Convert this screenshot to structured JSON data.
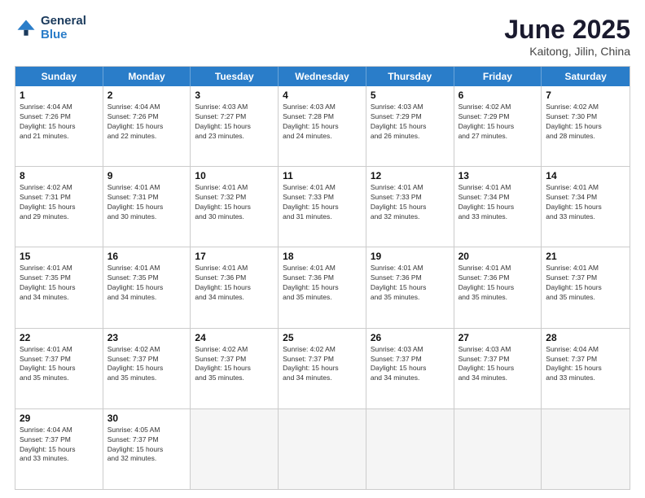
{
  "header": {
    "logo_line1": "General",
    "logo_line2": "Blue",
    "month": "June 2025",
    "location": "Kaitong, Jilin, China"
  },
  "weekdays": [
    "Sunday",
    "Monday",
    "Tuesday",
    "Wednesday",
    "Thursday",
    "Friday",
    "Saturday"
  ],
  "rows": [
    [
      {
        "day": "",
        "empty": true,
        "lines": []
      },
      {
        "day": "2",
        "empty": false,
        "lines": [
          "Sunrise: 4:04 AM",
          "Sunset: 7:26 PM",
          "Daylight: 15 hours",
          "and 22 minutes."
        ]
      },
      {
        "day": "3",
        "empty": false,
        "lines": [
          "Sunrise: 4:03 AM",
          "Sunset: 7:27 PM",
          "Daylight: 15 hours",
          "and 23 minutes."
        ]
      },
      {
        "day": "4",
        "empty": false,
        "lines": [
          "Sunrise: 4:03 AM",
          "Sunset: 7:28 PM",
          "Daylight: 15 hours",
          "and 24 minutes."
        ]
      },
      {
        "day": "5",
        "empty": false,
        "lines": [
          "Sunrise: 4:03 AM",
          "Sunset: 7:29 PM",
          "Daylight: 15 hours",
          "and 26 minutes."
        ]
      },
      {
        "day": "6",
        "empty": false,
        "lines": [
          "Sunrise: 4:02 AM",
          "Sunset: 7:29 PM",
          "Daylight: 15 hours",
          "and 27 minutes."
        ]
      },
      {
        "day": "7",
        "empty": false,
        "lines": [
          "Sunrise: 4:02 AM",
          "Sunset: 7:30 PM",
          "Daylight: 15 hours",
          "and 28 minutes."
        ]
      }
    ],
    [
      {
        "day": "8",
        "empty": false,
        "lines": [
          "Sunrise: 4:02 AM",
          "Sunset: 7:31 PM",
          "Daylight: 15 hours",
          "and 29 minutes."
        ]
      },
      {
        "day": "9",
        "empty": false,
        "lines": [
          "Sunrise: 4:01 AM",
          "Sunset: 7:31 PM",
          "Daylight: 15 hours",
          "and 30 minutes."
        ]
      },
      {
        "day": "10",
        "empty": false,
        "lines": [
          "Sunrise: 4:01 AM",
          "Sunset: 7:32 PM",
          "Daylight: 15 hours",
          "and 30 minutes."
        ]
      },
      {
        "day": "11",
        "empty": false,
        "lines": [
          "Sunrise: 4:01 AM",
          "Sunset: 7:33 PM",
          "Daylight: 15 hours",
          "and 31 minutes."
        ]
      },
      {
        "day": "12",
        "empty": false,
        "lines": [
          "Sunrise: 4:01 AM",
          "Sunset: 7:33 PM",
          "Daylight: 15 hours",
          "and 32 minutes."
        ]
      },
      {
        "day": "13",
        "empty": false,
        "lines": [
          "Sunrise: 4:01 AM",
          "Sunset: 7:34 PM",
          "Daylight: 15 hours",
          "and 33 minutes."
        ]
      },
      {
        "day": "14",
        "empty": false,
        "lines": [
          "Sunrise: 4:01 AM",
          "Sunset: 7:34 PM",
          "Daylight: 15 hours",
          "and 33 minutes."
        ]
      }
    ],
    [
      {
        "day": "15",
        "empty": false,
        "lines": [
          "Sunrise: 4:01 AM",
          "Sunset: 7:35 PM",
          "Daylight: 15 hours",
          "and 34 minutes."
        ]
      },
      {
        "day": "16",
        "empty": false,
        "lines": [
          "Sunrise: 4:01 AM",
          "Sunset: 7:35 PM",
          "Daylight: 15 hours",
          "and 34 minutes."
        ]
      },
      {
        "day": "17",
        "empty": false,
        "lines": [
          "Sunrise: 4:01 AM",
          "Sunset: 7:36 PM",
          "Daylight: 15 hours",
          "and 34 minutes."
        ]
      },
      {
        "day": "18",
        "empty": false,
        "lines": [
          "Sunrise: 4:01 AM",
          "Sunset: 7:36 PM",
          "Daylight: 15 hours",
          "and 35 minutes."
        ]
      },
      {
        "day": "19",
        "empty": false,
        "lines": [
          "Sunrise: 4:01 AM",
          "Sunset: 7:36 PM",
          "Daylight: 15 hours",
          "and 35 minutes."
        ]
      },
      {
        "day": "20",
        "empty": false,
        "lines": [
          "Sunrise: 4:01 AM",
          "Sunset: 7:36 PM",
          "Daylight: 15 hours",
          "and 35 minutes."
        ]
      },
      {
        "day": "21",
        "empty": false,
        "lines": [
          "Sunrise: 4:01 AM",
          "Sunset: 7:37 PM",
          "Daylight: 15 hours",
          "and 35 minutes."
        ]
      }
    ],
    [
      {
        "day": "22",
        "empty": false,
        "lines": [
          "Sunrise: 4:01 AM",
          "Sunset: 7:37 PM",
          "Daylight: 15 hours",
          "and 35 minutes."
        ]
      },
      {
        "day": "23",
        "empty": false,
        "lines": [
          "Sunrise: 4:02 AM",
          "Sunset: 7:37 PM",
          "Daylight: 15 hours",
          "and 35 minutes."
        ]
      },
      {
        "day": "24",
        "empty": false,
        "lines": [
          "Sunrise: 4:02 AM",
          "Sunset: 7:37 PM",
          "Daylight: 15 hours",
          "and 35 minutes."
        ]
      },
      {
        "day": "25",
        "empty": false,
        "lines": [
          "Sunrise: 4:02 AM",
          "Sunset: 7:37 PM",
          "Daylight: 15 hours",
          "and 34 minutes."
        ]
      },
      {
        "day": "26",
        "empty": false,
        "lines": [
          "Sunrise: 4:03 AM",
          "Sunset: 7:37 PM",
          "Daylight: 15 hours",
          "and 34 minutes."
        ]
      },
      {
        "day": "27",
        "empty": false,
        "lines": [
          "Sunrise: 4:03 AM",
          "Sunset: 7:37 PM",
          "Daylight: 15 hours",
          "and 34 minutes."
        ]
      },
      {
        "day": "28",
        "empty": false,
        "lines": [
          "Sunrise: 4:04 AM",
          "Sunset: 7:37 PM",
          "Daylight: 15 hours",
          "and 33 minutes."
        ]
      }
    ],
    [
      {
        "day": "29",
        "empty": false,
        "lines": [
          "Sunrise: 4:04 AM",
          "Sunset: 7:37 PM",
          "Daylight: 15 hours",
          "and 33 minutes."
        ]
      },
      {
        "day": "30",
        "empty": false,
        "lines": [
          "Sunrise: 4:05 AM",
          "Sunset: 7:37 PM",
          "Daylight: 15 hours",
          "and 32 minutes."
        ]
      },
      {
        "day": "",
        "empty": true,
        "lines": []
      },
      {
        "day": "",
        "empty": true,
        "lines": []
      },
      {
        "day": "",
        "empty": true,
        "lines": []
      },
      {
        "day": "",
        "empty": true,
        "lines": []
      },
      {
        "day": "",
        "empty": true,
        "lines": []
      }
    ]
  ],
  "first_row_sunday": {
    "day": "1",
    "lines": [
      "Sunrise: 4:04 AM",
      "Sunset: 7:26 PM",
      "Daylight: 15 hours",
      "and 21 minutes."
    ]
  }
}
